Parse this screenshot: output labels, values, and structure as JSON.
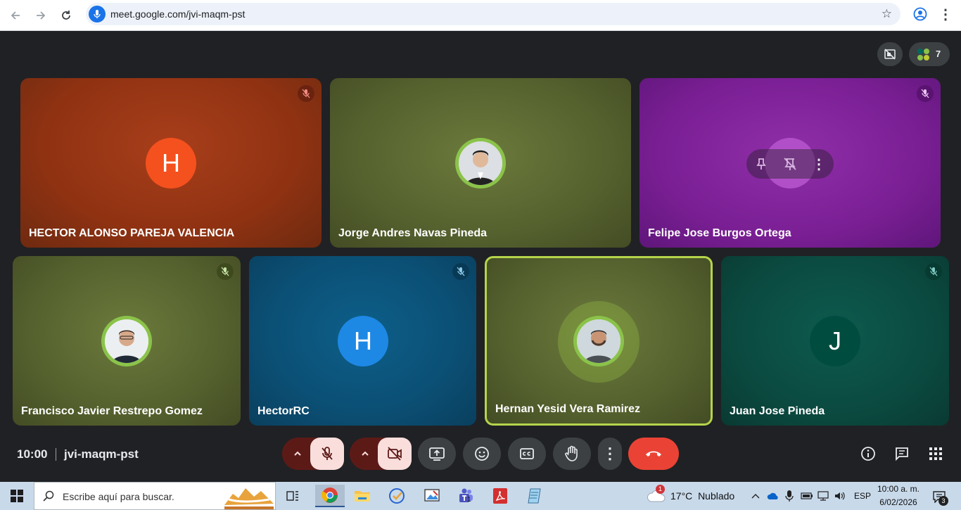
{
  "browser": {
    "url": "meet.google.com/jvi-maqm-pst",
    "back_icon": "arrow-left-icon",
    "forward_icon": "arrow-right-icon",
    "reload_icon": "reload-icon"
  },
  "meeting": {
    "time": "10:00",
    "code": "jvi-maqm-pst",
    "participant_count": "7"
  },
  "participants": [
    {
      "name": "HECTOR ALONSO PAREJA VALENCIA",
      "initial": "H",
      "muted": true,
      "color": "#f4511e"
    },
    {
      "name": "Jorge Andres Navas Pineda",
      "initial": "",
      "muted": false,
      "color": "#8bc34a"
    },
    {
      "name": "Felipe Jose Burgos Ortega",
      "initial": "",
      "muted": true,
      "color": "#8e24aa"
    },
    {
      "name": "Francisco Javier Restrepo Gomez",
      "initial": "",
      "muted": true,
      "color": "#8bc34a"
    },
    {
      "name": "HectorRC",
      "initial": "H",
      "muted": true,
      "color": "#039be5"
    },
    {
      "name": "Hernan Yesid Vera Ramirez",
      "initial": "",
      "muted": false,
      "speaking": true,
      "color": "#8bc34a"
    },
    {
      "name": "Juan Jose Pineda",
      "initial": "J",
      "muted": true,
      "color": "#00695c"
    }
  ],
  "taskbar": {
    "search_placeholder": "Escribe aquí para buscar.",
    "weather_temp": "17°C",
    "weather_desc": "Nublado",
    "weather_badge": "1",
    "language": "ESP",
    "time": "10:00 a. m.",
    "date": "6/02/2026",
    "notifications": "3",
    "teams_badge": "1"
  },
  "colors": {
    "end_call": "#ea4335",
    "muted_control": "#f9dedc",
    "accent": "#1a73e8"
  }
}
